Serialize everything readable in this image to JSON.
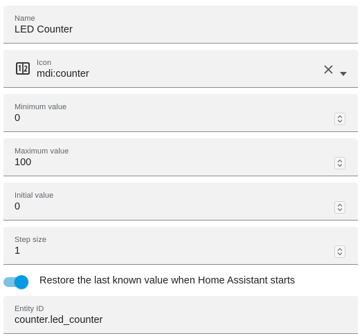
{
  "name_field": {
    "label": "Name",
    "value": "LED Counter"
  },
  "icon_field": {
    "label": "Icon",
    "value": "mdi:counter",
    "icon": "counter-icon"
  },
  "minimum_field": {
    "label": "Minimum value",
    "value": "0"
  },
  "maximum_field": {
    "label": "Maximum value",
    "value": "100"
  },
  "initial_field": {
    "label": "Initial value",
    "value": "0"
  },
  "step_field": {
    "label": "Step size",
    "value": "1"
  },
  "restore_toggle": {
    "label": "Restore the last known value when Home Assistant starts",
    "checked": true
  },
  "entity_field": {
    "label": "Entity ID",
    "value": "counter.led_counter"
  },
  "colors": {
    "accent": "#039be5",
    "field_bg": "#f2f2f2"
  }
}
